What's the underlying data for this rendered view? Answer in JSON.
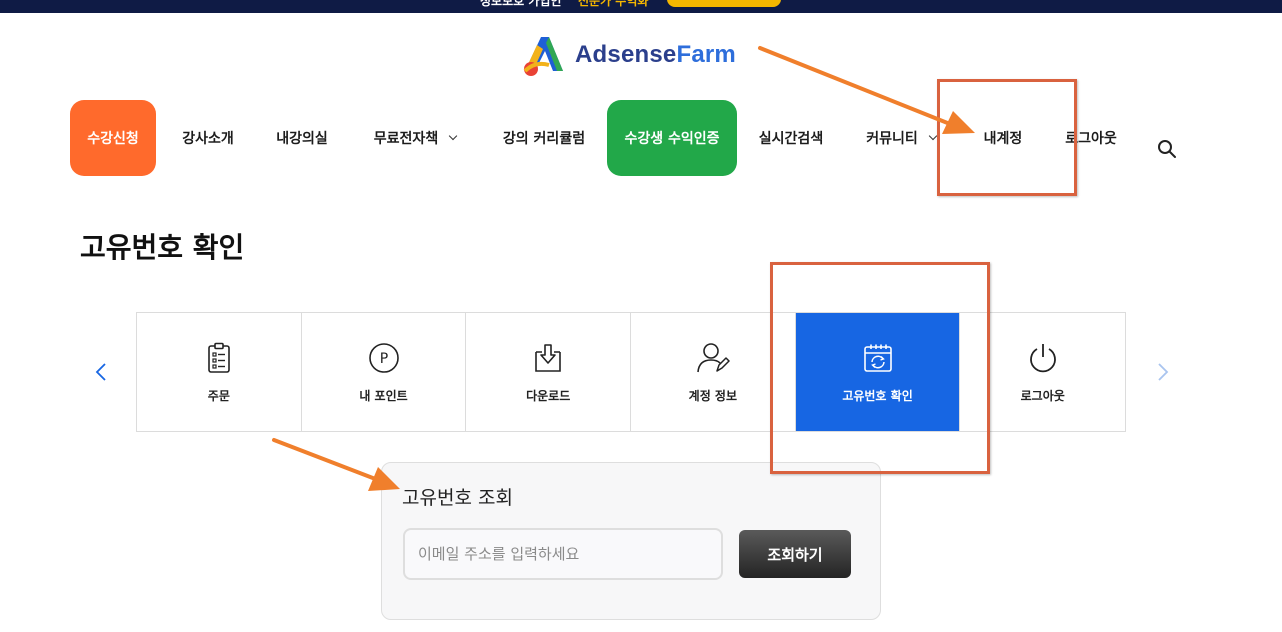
{
  "banner": {
    "fragment_left": "정보보호 가입인",
    "fragment_right": "전문가 수익화"
  },
  "logo": {
    "part1": "Adsense",
    "part2": "Farm"
  },
  "nav": {
    "items": [
      {
        "label": "수강신청"
      },
      {
        "label": "강사소개"
      },
      {
        "label": "내강의실"
      },
      {
        "label": "무료전자책"
      },
      {
        "label": "강의 커리큘럼"
      },
      {
        "label": "수강생 수익인증"
      },
      {
        "label": "실시간검색"
      },
      {
        "label": "커뮤니티"
      },
      {
        "label": "내계정"
      },
      {
        "label": "로그아웃"
      }
    ],
    "search_icon": "search-icon"
  },
  "page": {
    "title": "고유번호 확인"
  },
  "account_tabs": [
    {
      "label": "주문",
      "icon": "clipboard-list-icon"
    },
    {
      "label": "내 포인트",
      "icon": "point-circle-icon"
    },
    {
      "label": "다운로드",
      "icon": "download-icon"
    },
    {
      "label": "계정 정보",
      "icon": "user-edit-icon"
    },
    {
      "label": "고유번호 확인",
      "icon": "calendar-refresh-icon",
      "active": true
    },
    {
      "label": "로그아웃",
      "icon": "power-icon"
    }
  ],
  "lookup": {
    "title": "고유번호 조회",
    "placeholder": "이메일 주소를 입력하세요",
    "button": "조회하기"
  },
  "colors": {
    "nav_orange": "#ff6a2c",
    "nav_green": "#22a849",
    "active_tab": "#1766e3",
    "annotation": "#f07f2c",
    "highlight_box": "#d9623f"
  }
}
